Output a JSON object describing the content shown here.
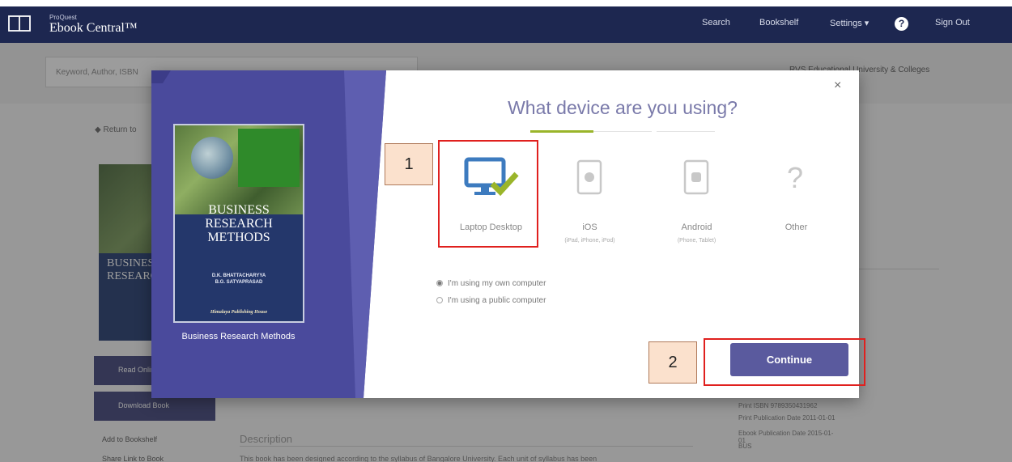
{
  "header": {
    "brand_small": "ProQuest",
    "brand_name": "Ebook Central™",
    "nav": {
      "search": "Search",
      "bookshelf": "Bookshelf",
      "settings": "Settings ▾",
      "help": "?",
      "sign_out": "Sign Out"
    }
  },
  "background": {
    "search_placeholder": "Keyword, Author, ISBN",
    "institution": "RVS Educational University & Colleges",
    "return_link": "◆ Return to",
    "cover_title": "BUSINESS RESEARCH",
    "read_online": "Read Online",
    "download_book": "Download Book",
    "add_bookshelf": "Add to Bookshelf",
    "share_link": "Share Link to Book",
    "description_heading": "Description",
    "description_text": "This book has been designed according to the syllabus of Bangalore University. Each unit of syllabus has been",
    "meta": [
      "Print ISBN 9789350431962",
      "Print Publication Date 2011-01-01",
      "Ebook Publication Date 2015-01-01",
      "BUS"
    ]
  },
  "modal": {
    "close": "×",
    "title": "What device are you using?",
    "book": {
      "title": "BUSINESS RESEARCH METHODS",
      "authors": [
        "D.K. BHATTACHARYYA",
        "B.G. SATYAPRASAD"
      ],
      "publisher": "Himalaya Publishing House",
      "caption": "Business Research Methods"
    },
    "devices": [
      {
        "name": "laptop-desktop",
        "label": "Laptop Desktop",
        "sub": "",
        "selected": true
      },
      {
        "name": "ios",
        "label": "iOS",
        "sub": "(iPad, iPhone, iPod)",
        "selected": false
      },
      {
        "name": "android",
        "label": "Android",
        "sub": "(Phone, Tablet)",
        "selected": false
      },
      {
        "name": "other",
        "label": "Other",
        "sub": "",
        "selected": false
      }
    ],
    "options": [
      {
        "label": "I'm using my own computer",
        "checked": true
      },
      {
        "label": "I'm using a public computer",
        "checked": false
      }
    ],
    "continue_label": "Continue"
  },
  "annotations": {
    "step1": "1",
    "step2": "2"
  },
  "colors": {
    "header_bg": "#1d2750",
    "modal_left_bg": "#4a4a9c",
    "accent_green": "#9ab52a",
    "continue_bg": "#5a5a9e",
    "annotation_red": "#e0201e"
  }
}
